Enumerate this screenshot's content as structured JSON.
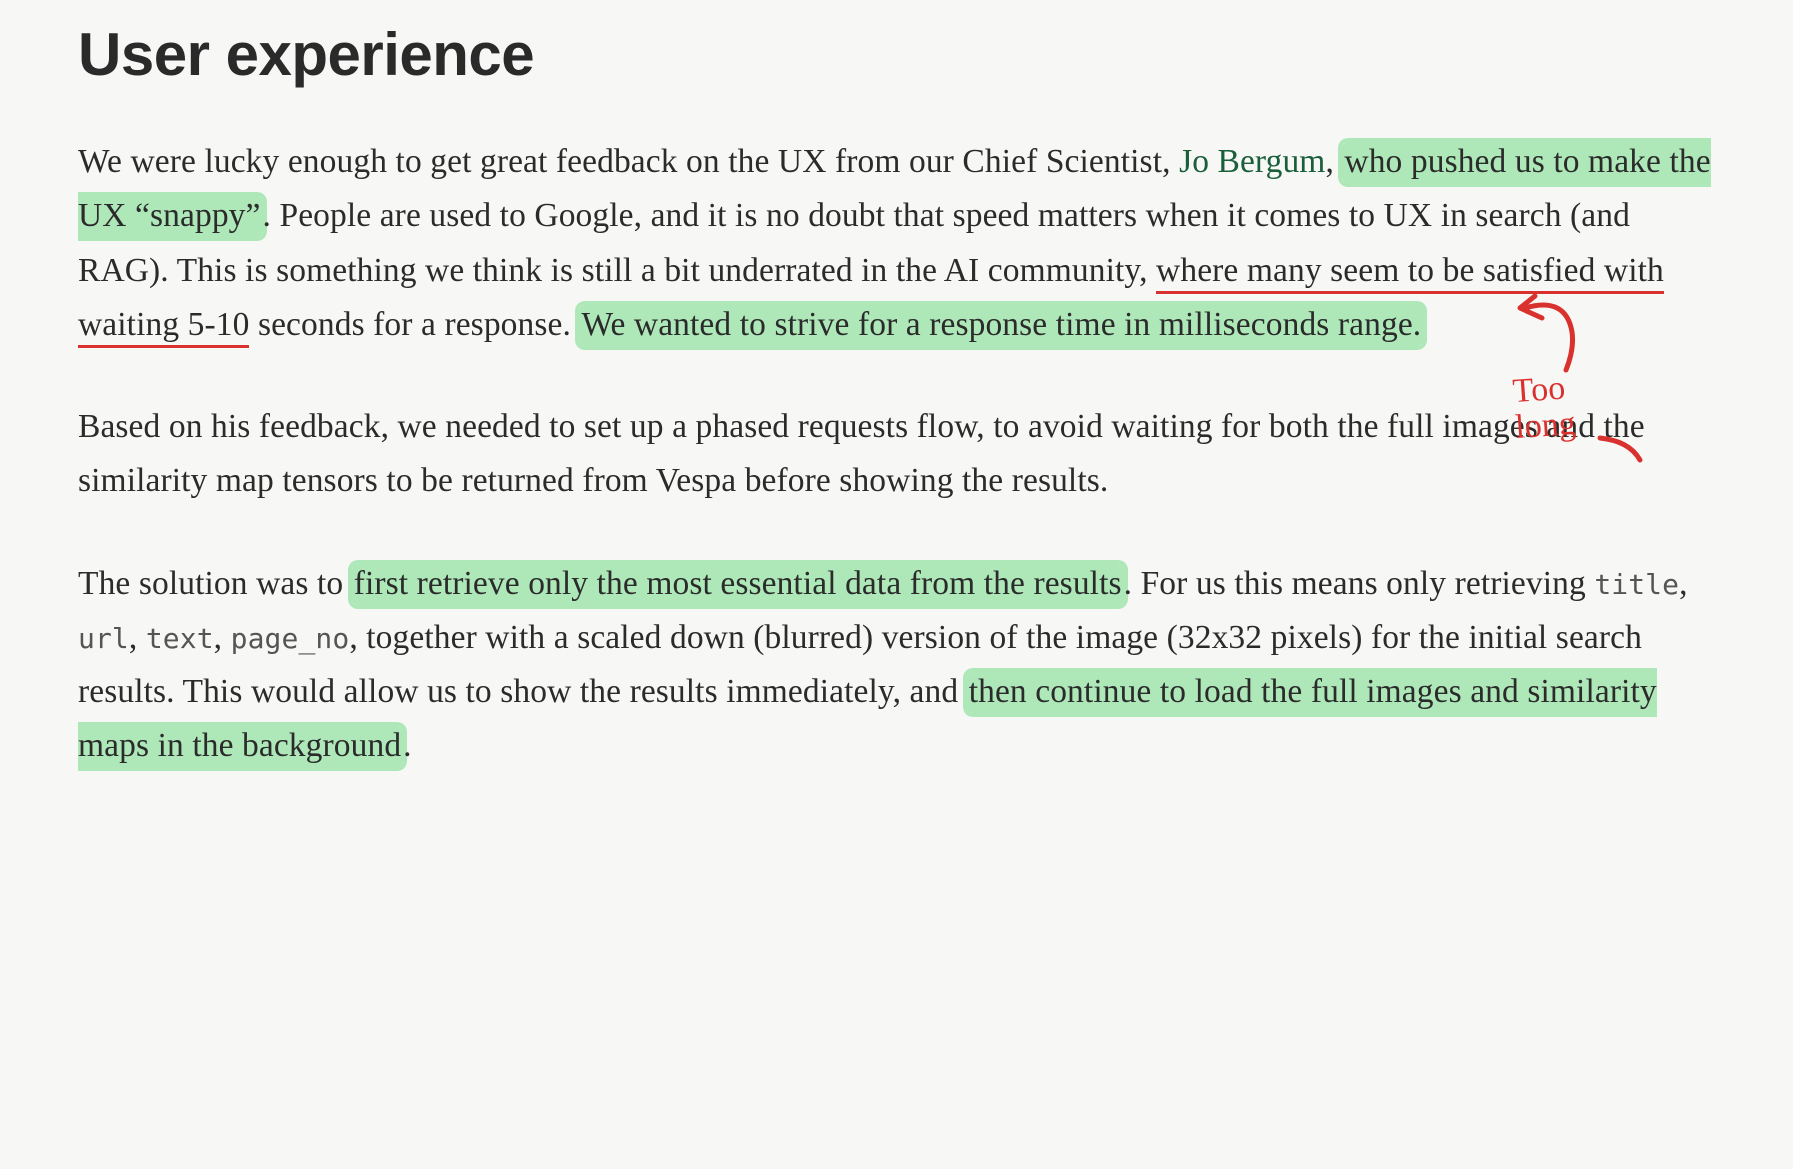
{
  "heading": "User experience",
  "p1": {
    "t1": "We were lucky enough to get great feedback on the UX from our Chief Scientist, ",
    "link": "Jo Bergum",
    "t2": ", ",
    "hl1": "who pushed us to make the UX “snappy”",
    "t3": ". People are used to Google, and it is no doubt that speed matters when it comes to UX in search (and RAG). This is something we think is still a bit underrated in the AI community, ",
    "ul": "where many seem to be satisfied with waiting 5-10",
    "t4": " seconds for a response. ",
    "hl2": "We wanted to strive for a response time in milliseconds range.",
    "t5": ""
  },
  "p2": {
    "t1": "Based on his feedback, we needed to set up a phased requests flow, to avoid waiting for both the full images and the similarity map tensors to be returned from Vespa before showing the results."
  },
  "p3": {
    "t1": "The solution was to ",
    "hl1": "first retrieve only the most essential data from the results",
    "t2": ". For us this means only retrieving ",
    "code1": "title",
    "c1": ", ",
    "code2": "url",
    "c2": ", ",
    "code3": "text",
    "c3": ", ",
    "code4": "page_no",
    "t3": ", together with a scaled down (blurred) version of the image (32x32 pixels) for the initial search results. This would allow us to show the results immediately, and ",
    "hl2": "then continue to load the full images and similarity maps in the background",
    "t4": "."
  },
  "annotation": {
    "text": "Too\nlong"
  }
}
